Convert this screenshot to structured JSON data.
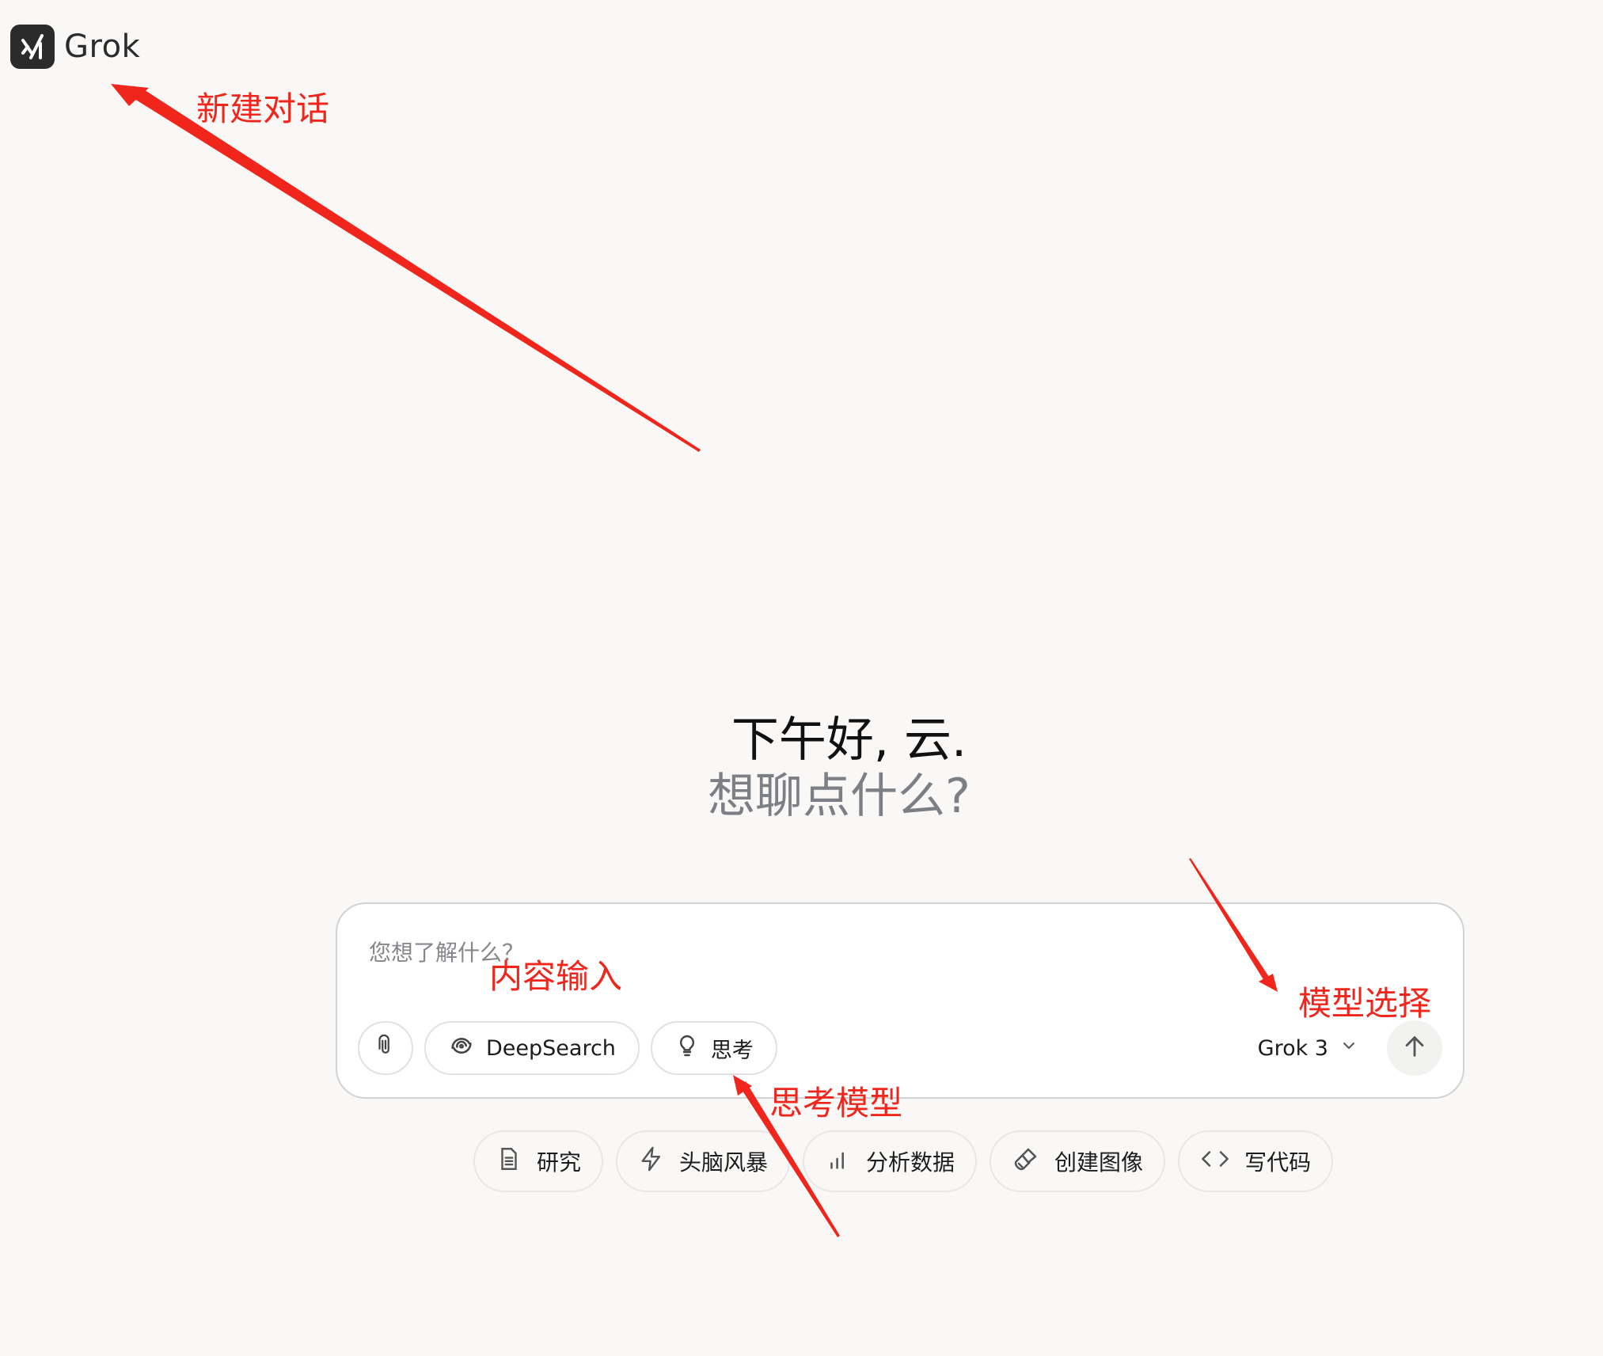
{
  "header": {
    "logo_text": "Grok",
    "logo_icon": "grok-logo-icon"
  },
  "greeting": {
    "line1": "下午好, 云.",
    "line2": "想聊点什么?"
  },
  "composer": {
    "placeholder": "您想了解什么？",
    "attach_icon": "paperclip-icon",
    "deepsearch_label": "DeepSearch",
    "think_label": "思考",
    "model_label": "Grok 3",
    "send_icon": "arrow-up-icon"
  },
  "suggestions": [
    {
      "label": "研究",
      "icon": "document-icon"
    },
    {
      "label": "头脑风暴",
      "icon": "lightning-icon"
    },
    {
      "label": "分析数据",
      "icon": "bar-chart-icon"
    },
    {
      "label": "创建图像",
      "icon": "paintbrush-icon"
    },
    {
      "label": "写代码",
      "icon": "code-icon"
    }
  ],
  "annotations": {
    "new_chat": "新建对话",
    "content_input": "内容输入",
    "model_select": "模型选择",
    "think_model": "思考模型",
    "color": "#f0261c"
  },
  "colors": {
    "background": "#f9f8f6",
    "accent_annotation": "#f0261c",
    "muted_text": "#7c7f86"
  }
}
